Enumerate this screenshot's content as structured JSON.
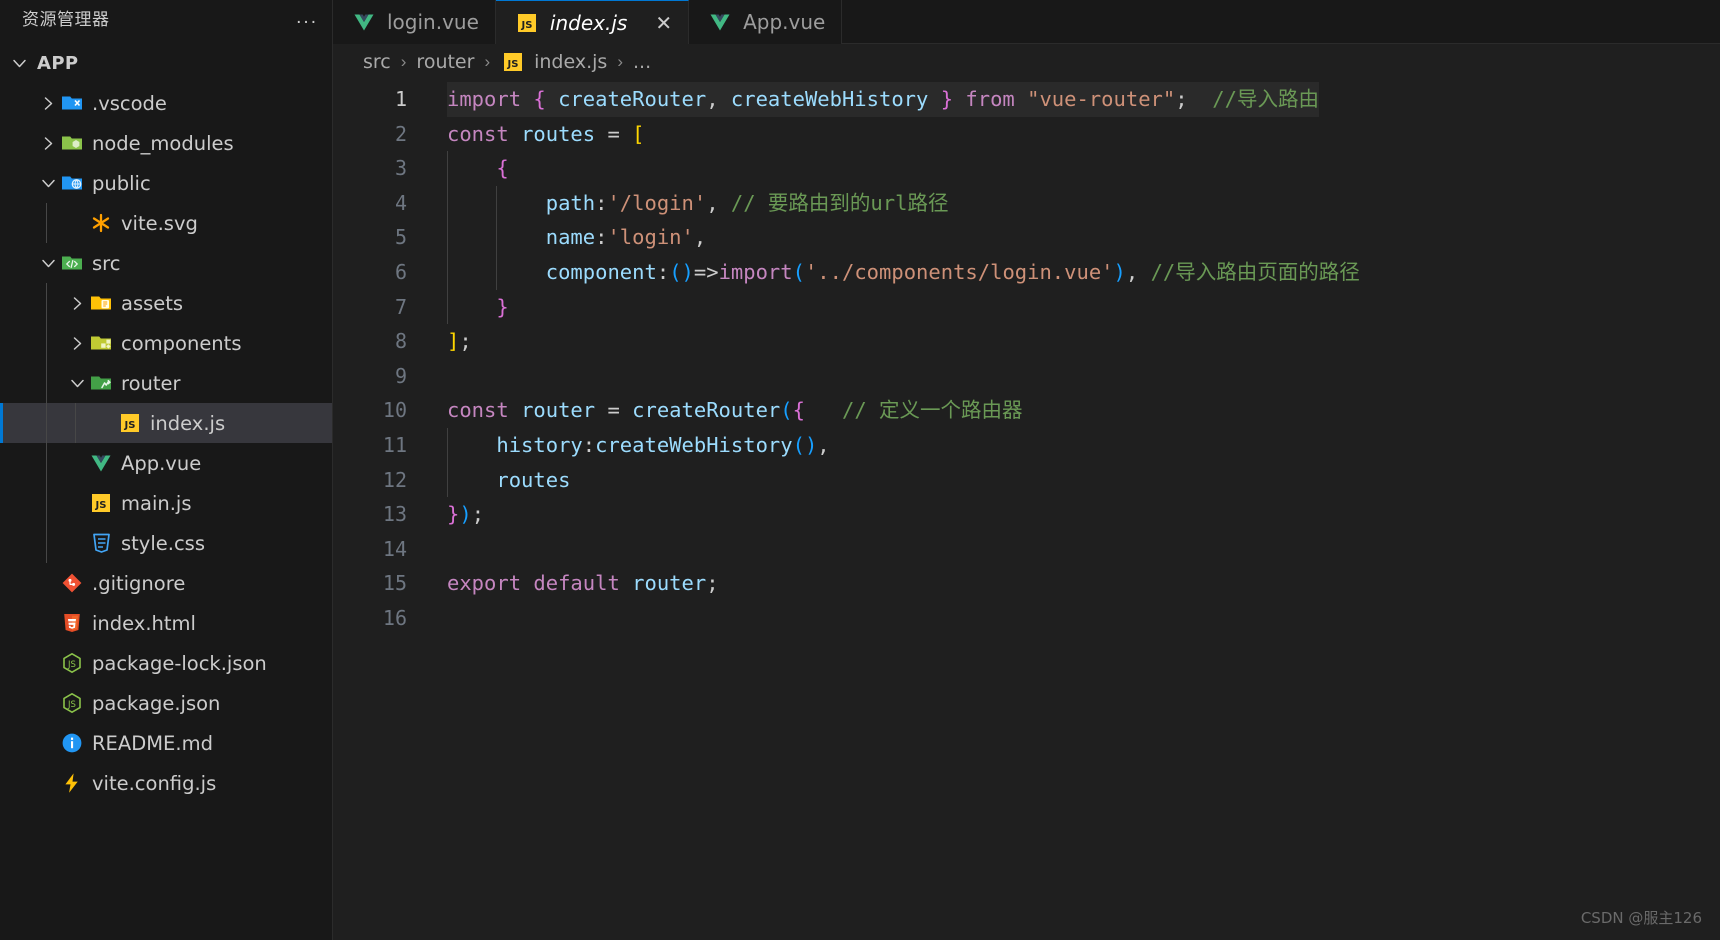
{
  "sidebar": {
    "title": "资源管理器",
    "more_actions": "...",
    "root": {
      "label": "APP",
      "expanded": true
    },
    "items": [
      {
        "label": ".vscode",
        "icon": "vscode-folder-icon",
        "kind": "folder",
        "expanded": false,
        "depth": 1
      },
      {
        "label": "node_modules",
        "icon": "node-folder-icon",
        "kind": "folder",
        "expanded": false,
        "depth": 1
      },
      {
        "label": "public",
        "icon": "public-folder-icon",
        "kind": "folder",
        "expanded": true,
        "depth": 1
      },
      {
        "label": "vite.svg",
        "icon": "vite-icon",
        "kind": "file",
        "depth": 2
      },
      {
        "label": "src",
        "icon": "src-folder-icon",
        "kind": "folder",
        "expanded": true,
        "depth": 1
      },
      {
        "label": "assets",
        "icon": "assets-folder-icon",
        "kind": "folder",
        "expanded": false,
        "depth": 2
      },
      {
        "label": "components",
        "icon": "components-folder-icon",
        "kind": "folder",
        "expanded": false,
        "depth": 2
      },
      {
        "label": "router",
        "icon": "router-folder-icon",
        "kind": "folder",
        "expanded": true,
        "depth": 2
      },
      {
        "label": "index.js",
        "icon": "js-icon",
        "kind": "file",
        "depth": 3,
        "selected": true
      },
      {
        "label": "App.vue",
        "icon": "vue-icon",
        "kind": "file",
        "depth": 2
      },
      {
        "label": "main.js",
        "icon": "js-icon",
        "kind": "file",
        "depth": 2
      },
      {
        "label": "style.css",
        "icon": "css-icon",
        "kind": "file",
        "depth": 2
      },
      {
        "label": ".gitignore",
        "icon": "git-icon",
        "kind": "file",
        "depth": 1
      },
      {
        "label": "index.html",
        "icon": "html-icon",
        "kind": "file",
        "depth": 1
      },
      {
        "label": "package-lock.json",
        "icon": "nodejs-icon",
        "kind": "file",
        "depth": 1
      },
      {
        "label": "package.json",
        "icon": "nodejs-icon",
        "kind": "file",
        "depth": 1
      },
      {
        "label": "README.md",
        "icon": "info-icon",
        "kind": "file",
        "depth": 1
      },
      {
        "label": "vite.config.js",
        "icon": "vite-config-icon",
        "kind": "file",
        "depth": 1
      }
    ]
  },
  "tabs": [
    {
      "label": "login.vue",
      "icon": "vue-icon",
      "active": false,
      "closable": false
    },
    {
      "label": "index.js",
      "icon": "js-icon",
      "active": true,
      "closable": true,
      "close_label": "✕",
      "preview": true
    },
    {
      "label": "App.vue",
      "icon": "vue-icon",
      "active": false,
      "closable": false
    }
  ],
  "breadcrumb": {
    "parts": [
      "src",
      "router",
      "index.js",
      "..."
    ],
    "separator": "›",
    "file_icon": "js-icon"
  },
  "editor": {
    "language": "javascript",
    "line_numbers": [
      "1",
      "2",
      "3",
      "4",
      "5",
      "6",
      "7",
      "8",
      "9",
      "10",
      "11",
      "12",
      "13",
      "14",
      "15",
      "16"
    ],
    "current_line": 1,
    "watermark": "CSDN @服主126",
    "code_text": [
      "import { createRouter, createWebHistory } from \"vue-router\";  //导入路由",
      "const routes = [",
      "    {",
      "        path:'/login', // 要路由到的url路径",
      "        name:'login',",
      "        component:()=>import('../components/login.vue'), //导入路由页面的路径",
      "    }",
      "];",
      "",
      "const router = createRouter({   // 定义一个路由器",
      "    history:createWebHistory(),",
      "    routes",
      "});",
      "",
      "export default router;",
      ""
    ]
  },
  "colors": {
    "accent": "#0078d4",
    "editor_bg": "#1f1f1f",
    "sidebar_bg": "#181818",
    "selection_bg": "#37373d",
    "keyword": "#c586c0",
    "string": "#ce9178",
    "comment": "#6a9955",
    "variable": "#9cdcfe",
    "function": "#dcdcaa",
    "blue_keyword": "#569cd6"
  }
}
